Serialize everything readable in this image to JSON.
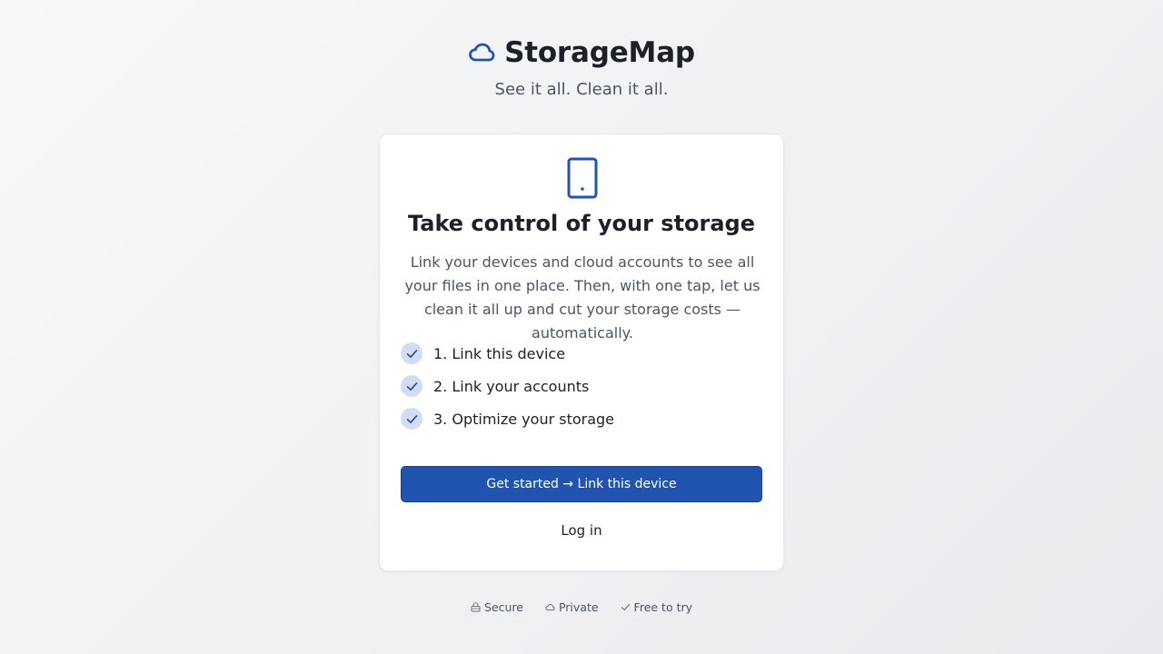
{
  "brand": {
    "name": "StorageMap",
    "tagline": "See it all. Clean it all.",
    "icon": "cloud-icon",
    "accent_color": "#2153b0"
  },
  "card": {
    "icon": "smartphone-icon",
    "title": "Take control of your storage",
    "description": "Link your devices and cloud accounts to see all your files in one place. Then, with one tap, let us clean it all up and cut your storage costs — automatically.",
    "steps": [
      {
        "label": "1. Link this device",
        "icon": "check-icon"
      },
      {
        "label": "2. Link your accounts",
        "icon": "check-icon"
      },
      {
        "label": "3. Optimize your storage",
        "icon": "check-icon"
      }
    ],
    "primary_button": "Get started → Link this device",
    "secondary_link": "Log in"
  },
  "footer": {
    "items": [
      {
        "label": "Secure",
        "icon": "lock-icon"
      },
      {
        "label": "Private",
        "icon": "cloud-icon"
      },
      {
        "label": "Free to try",
        "icon": "check-icon"
      }
    ]
  }
}
